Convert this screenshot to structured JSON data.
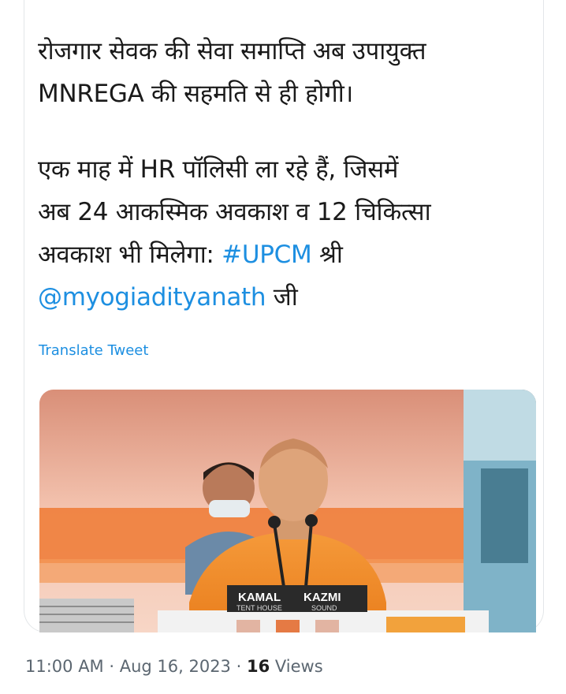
{
  "tweet": {
    "line1": "रोजगार सेवक की सेवा समाप्ति अब उपायुक्त",
    "line2": "MNREGA की सहमति से ही होगी।",
    "line3": "एक माह में HR पॉलिसी ला रहे हैं, जिसमें",
    "line4": "अब 24 आकस्मिक अवकाश व 12 चिकित्सा",
    "line5_text": "अवकाश भी मिलेगा: ",
    "hashtag": "#UPCM",
    "line5_tail": " श्री",
    "mention": "@myogiadityanath",
    "line6_tail": " जी"
  },
  "translate_label": "Translate Tweet",
  "media": {
    "podium_text_1": "KAMAL",
    "podium_text_2": "KAZMI",
    "podium_text_3": "TENT HOUSE",
    "podium_text_4": "SOUND"
  },
  "meta": {
    "time": "11:00 AM",
    "separator": " · ",
    "date": "Aug 16, 2023",
    "views_count": "16",
    "views_label": " Views"
  }
}
